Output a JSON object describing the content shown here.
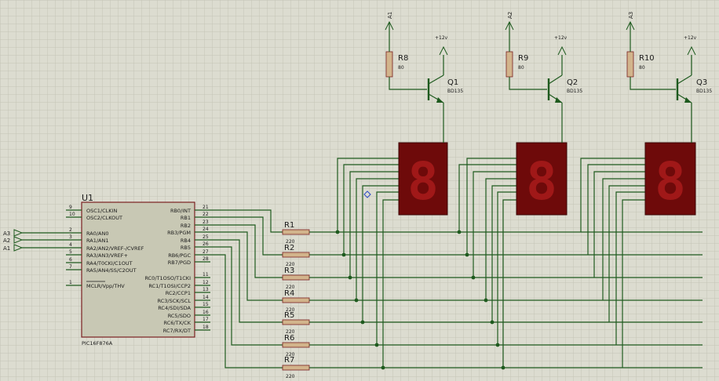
{
  "mcu": {
    "ref": "U1",
    "part": "PIC16F876A",
    "left_pins": [
      {
        "num": "9",
        "name": "OSC1/CLKIN"
      },
      {
        "num": "10",
        "name": "OSC2/CLKOUT"
      },
      {
        "num": "2",
        "name": "RA0/AN0"
      },
      {
        "num": "3",
        "name": "RA1/AN1"
      },
      {
        "num": "4",
        "name": "RA2/AN2/VREF-/CVREF"
      },
      {
        "num": "5",
        "name": "RA3/AN3/VREF+"
      },
      {
        "num": "6",
        "name": "RA4/T0CKI/C1OUT"
      },
      {
        "num": "7",
        "name": "RA5/AN4/SS/C2OUT"
      },
      {
        "num": "1",
        "name": "MCLR/Vpp/THV"
      }
    ],
    "right_pins": [
      {
        "num": "21",
        "name": "RB0/INT"
      },
      {
        "num": "22",
        "name": "RB1"
      },
      {
        "num": "23",
        "name": "RB2"
      },
      {
        "num": "24",
        "name": "RB3/PGM"
      },
      {
        "num": "25",
        "name": "RB4"
      },
      {
        "num": "26",
        "name": "RB5"
      },
      {
        "num": "27",
        "name": "RB6/PGC"
      },
      {
        "num": "28",
        "name": "RB7/PGD"
      },
      {
        "num": "11",
        "name": "RC0/T1OSO/T1CKI"
      },
      {
        "num": "12",
        "name": "RC1/T1OSI/CCP2"
      },
      {
        "num": "13",
        "name": "RC2/CCP1"
      },
      {
        "num": "14",
        "name": "RC3/SCK/SCL"
      },
      {
        "num": "15",
        "name": "RC4/SDI/SDA"
      },
      {
        "num": "16",
        "name": "RC5/SDO"
      },
      {
        "num": "17",
        "name": "RC6/TX/CK"
      },
      {
        "num": "18",
        "name": "RC7/RX/DT"
      }
    ]
  },
  "ports": [
    "A3",
    "A2",
    "A1"
  ],
  "seg_resistors": [
    {
      "ref": "R1",
      "value": "220"
    },
    {
      "ref": "R2",
      "value": "220"
    },
    {
      "ref": "R3",
      "value": "220"
    },
    {
      "ref": "R4",
      "value": "220"
    },
    {
      "ref": "R5",
      "value": "220"
    },
    {
      "ref": "R6",
      "value": "220"
    },
    {
      "ref": "R7",
      "value": "220"
    }
  ],
  "drivers": [
    {
      "net": "A1",
      "res_ref": "R8",
      "res_value": "80",
      "q_ref": "Q1",
      "q_part": "BD135",
      "supply": "+12v"
    },
    {
      "net": "A2",
      "res_ref": "R9",
      "res_value": "80",
      "q_ref": "Q2",
      "q_part": "BD135",
      "supply": "+12v"
    },
    {
      "net": "A3",
      "res_ref": "R10",
      "res_value": "80",
      "q_ref": "Q3",
      "q_part": "BD135",
      "supply": "+12v"
    }
  ],
  "digits": [
    "8",
    "8",
    "8"
  ],
  "colors": {
    "background": "#dcdcd0",
    "wire": "#1e5a1e",
    "chip_fill": "#c8c8b4",
    "chip_border": "#7a2020",
    "resistor_fill": "#d2b48c",
    "display_body": "#6e0a0a",
    "display_segment": "#a01818"
  }
}
